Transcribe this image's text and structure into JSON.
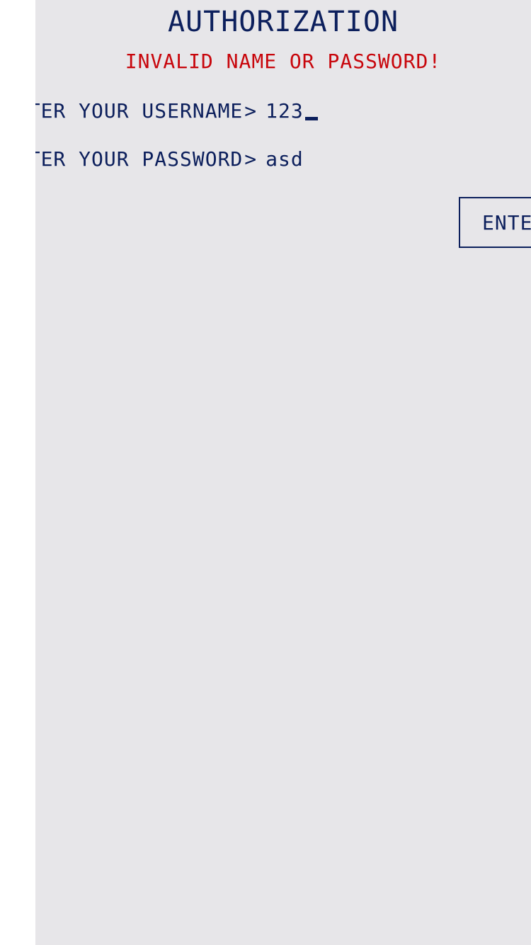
{
  "screen": {
    "title": "AUTHORIZATION",
    "error_message": "INVALID NAME OR PASSWORD!"
  },
  "form": {
    "username": {
      "label": "ENTER YOUR USERNAME",
      "prompt": ">",
      "value": "123"
    },
    "password": {
      "label": "ENTER YOUR PASSWORD",
      "prompt": ">",
      "value": "asd"
    },
    "submit_label": "ENTER"
  },
  "colors": {
    "background": "#e7e6e9",
    "text": "#0c1f5c",
    "error": "#c8060c"
  }
}
